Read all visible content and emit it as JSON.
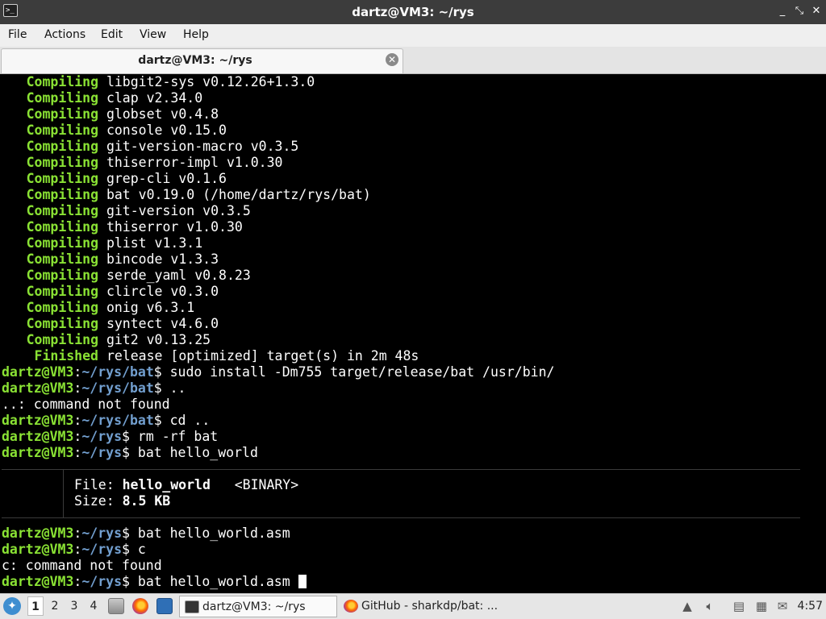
{
  "window": {
    "title": "dartz@VM3: ~/rys",
    "app_icon": "terminal-icon",
    "controls": {
      "minimize": "_",
      "maximize": "⤡",
      "close": "✕"
    }
  },
  "menu": {
    "items": [
      "File",
      "Actions",
      "Edit",
      "View",
      "Help"
    ]
  },
  "tabs": [
    {
      "label": "dartz@VM3: ~/rys",
      "close_icon": "close-circle-icon"
    }
  ],
  "terminal": {
    "colors": {
      "green": "#8ae234",
      "blue": "#729fcf",
      "text": "#ffffff",
      "background": "#000000"
    },
    "compile_lines": [
      {
        "status": "Compiling",
        "text": "libgit2-sys v0.12.26+1.3.0"
      },
      {
        "status": "Compiling",
        "text": "clap v2.34.0"
      },
      {
        "status": "Compiling",
        "text": "globset v0.4.8"
      },
      {
        "status": "Compiling",
        "text": "console v0.15.0"
      },
      {
        "status": "Compiling",
        "text": "git-version-macro v0.3.5"
      },
      {
        "status": "Compiling",
        "text": "thiserror-impl v1.0.30"
      },
      {
        "status": "Compiling",
        "text": "grep-cli v0.1.6"
      },
      {
        "status": "Compiling",
        "text": "bat v0.19.0 (/home/dartz/rys/bat)"
      },
      {
        "status": "Compiling",
        "text": "git-version v0.3.5"
      },
      {
        "status": "Compiling",
        "text": "thiserror v1.0.30"
      },
      {
        "status": "Compiling",
        "text": "plist v1.3.1"
      },
      {
        "status": "Compiling",
        "text": "bincode v1.3.3"
      },
      {
        "status": "Compiling",
        "text": "serde_yaml v0.8.23"
      },
      {
        "status": "Compiling",
        "text": "clircle v0.3.0"
      },
      {
        "status": "Compiling",
        "text": "onig v6.3.1"
      },
      {
        "status": "Compiling",
        "text": "syntect v4.6.0"
      },
      {
        "status": "Compiling",
        "text": "git2 v0.13.25"
      },
      {
        "status": "Finished",
        "text": "release [optimized] target(s) in 2m 48s"
      }
    ],
    "prompt_user": "dartz@VM3",
    "prompt_colon": ":",
    "prompt_symbol": "$",
    "history": [
      {
        "path": "~/rys/bat",
        "command": "sudo install -Dm755 target/release/bat /usr/bin/"
      },
      {
        "path": "~/rys/bat",
        "command": ".."
      },
      {
        "output": "..: command not found"
      },
      {
        "path": "~/rys/bat",
        "command": "cd .."
      },
      {
        "path": "~/rys",
        "command": "rm -rf bat"
      },
      {
        "path": "~/rys",
        "command": "bat hello_world"
      }
    ],
    "bat_output": {
      "file_label": "File:",
      "file_name": "hello_world",
      "file_tag": "<BINARY>",
      "size_label": "Size:",
      "size_value": "8.5 KB"
    },
    "history_after": [
      {
        "path": "~/rys",
        "command": "bat hello_world.asm"
      },
      {
        "path": "~/rys",
        "command": "c"
      },
      {
        "output": "c: command not found"
      },
      {
        "path": "~/rys",
        "command": "bat hello_world.asm",
        "cursor": true
      }
    ]
  },
  "taskbar": {
    "start_icon": "start-menu-icon",
    "desktops": [
      "1",
      "2",
      "3",
      "4"
    ],
    "active_desktop": "1",
    "launchers": [
      "file-manager-icon",
      "firefox-icon",
      "show-desktop-icon"
    ],
    "tasks": [
      {
        "label": "dartz@VM3: ~/rys",
        "icon": "terminal-icon",
        "active": true
      },
      {
        "label": "GitHub - sharkdp/bat: ...",
        "icon": "firefox-icon",
        "active": false
      }
    ],
    "tray_icons": [
      "update-icon",
      "volume-icon",
      "clipboard-icon",
      "network-icon",
      "notification-icon"
    ],
    "clock": "4:57"
  }
}
